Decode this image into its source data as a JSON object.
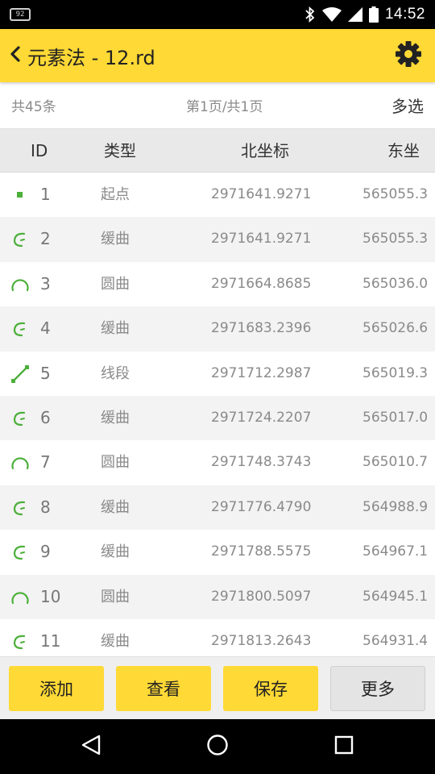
{
  "status_bar": {
    "notification_badge": "92",
    "icons": [
      "bluetooth-icon",
      "wifi-icon",
      "signal-icon",
      "battery-icon"
    ],
    "time": "14:52"
  },
  "app_bar": {
    "back_icon": "chevron-left-icon",
    "title": "元素法 - 12.rd",
    "settings_icon": "gear-icon",
    "color": "#ffd935"
  },
  "summary": {
    "total": "共45条",
    "page": "第1页/共1页",
    "multi_select": "多选"
  },
  "table": {
    "columns": [
      "ID",
      "类型",
      "北坐标",
      "东坐"
    ],
    "rows": [
      {
        "icon": "start-point-icon",
        "id": "1",
        "type": "起点",
        "north": "2971641.9271",
        "east": "565055.3"
      },
      {
        "icon": "spiral-curve-icon",
        "id": "2",
        "type": "缓曲",
        "north": "2971641.9271",
        "east": "565055.3"
      },
      {
        "icon": "circular-curve-icon",
        "id": "3",
        "type": "圆曲",
        "north": "2971664.8685",
        "east": "565036.0"
      },
      {
        "icon": "spiral-curve-icon",
        "id": "4",
        "type": "缓曲",
        "north": "2971683.2396",
        "east": "565026.6"
      },
      {
        "icon": "line-segment-icon",
        "id": "5",
        "type": "线段",
        "north": "2971712.2987",
        "east": "565019.3"
      },
      {
        "icon": "spiral-curve-icon",
        "id": "6",
        "type": "缓曲",
        "north": "2971724.2207",
        "east": "565017.0"
      },
      {
        "icon": "circular-curve-icon",
        "id": "7",
        "type": "圆曲",
        "north": "2971748.3743",
        "east": "565010.7"
      },
      {
        "icon": "spiral-curve-icon",
        "id": "8",
        "type": "缓曲",
        "north": "2971776.4790",
        "east": "564988.9"
      },
      {
        "icon": "spiral-curve-icon",
        "id": "9",
        "type": "缓曲",
        "north": "2971788.5575",
        "east": "564967.1"
      },
      {
        "icon": "circular-curve-icon",
        "id": "10",
        "type": "圆曲",
        "north": "2971800.5097",
        "east": "564945.1"
      },
      {
        "icon": "spiral-curve-icon",
        "id": "11",
        "type": "缓曲",
        "north": "2971813.2643",
        "east": "564931.4"
      }
    ],
    "icon_color": "#4cb03a"
  },
  "buttons": {
    "add": "添加",
    "view": "查看",
    "save": "保存",
    "more": "更多"
  },
  "nav_bar": {
    "icons": [
      "back-triangle-icon",
      "home-circle-icon",
      "recents-square-icon"
    ]
  }
}
